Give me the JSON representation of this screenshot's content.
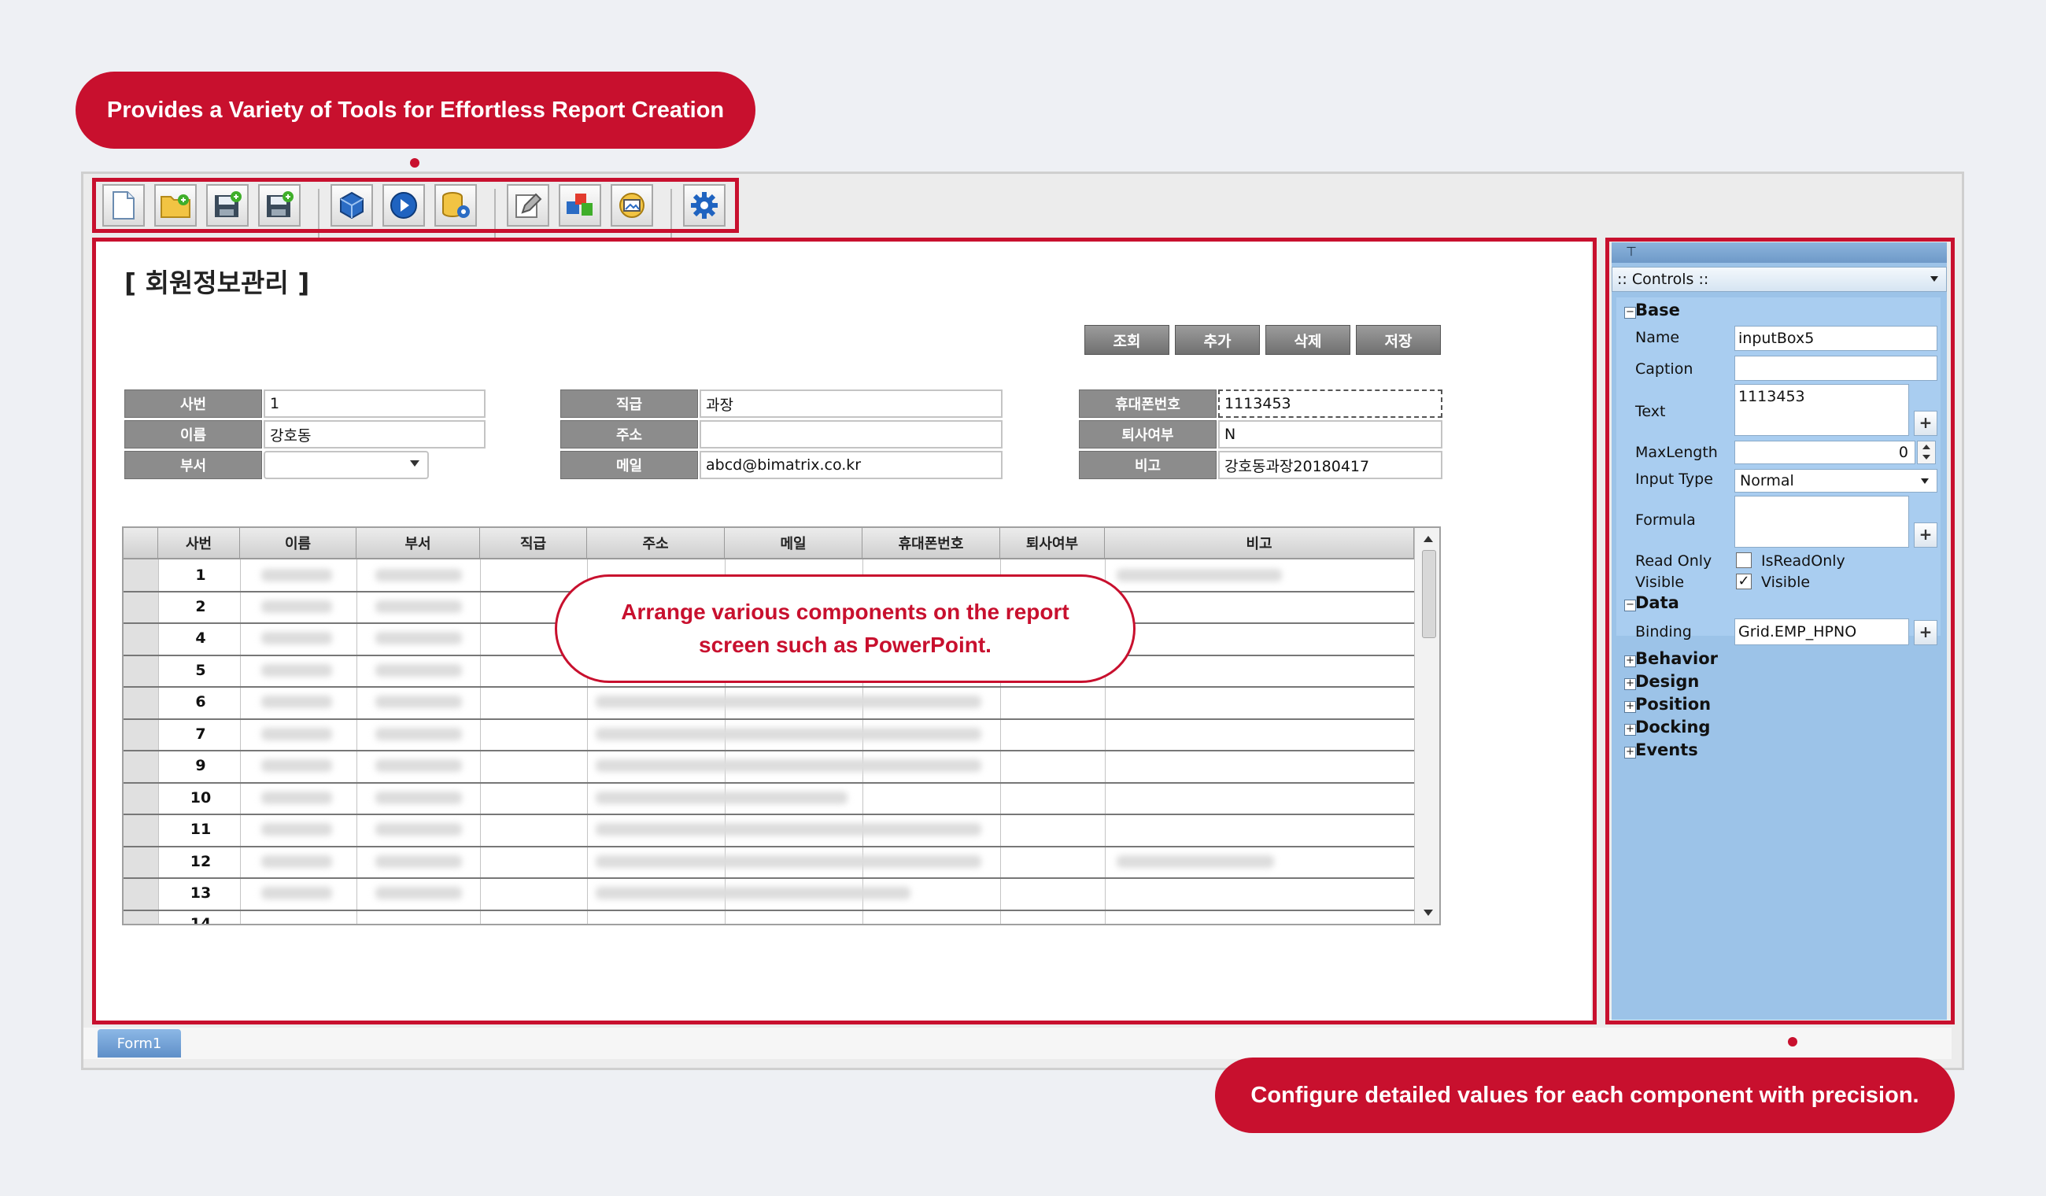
{
  "callouts": {
    "top": "Provides a Variety of Tools for Effortless Report Creation",
    "middle_line1": "Arrange various components on the report",
    "middle_line2": "screen such as PowerPoint.",
    "bottom": "Configure detailed values for each component with precision."
  },
  "colors": {
    "accent": "#c8102e",
    "panel": "#9cc3e8",
    "tab": "#6e9bd0"
  },
  "toolbar": {
    "icons": [
      "new-document-icon",
      "open-folder-icon",
      "save-icon",
      "save-as-icon",
      "component-cube-icon",
      "run-play-icon",
      "database-settings-icon",
      "edit-pencil-icon",
      "color-blocks-icon",
      "image-settings-icon",
      "gear-icon"
    ]
  },
  "form": {
    "title": "[ 회원정보관리 ]",
    "buttons": [
      "조회",
      "추가",
      "삭제",
      "저장"
    ],
    "fields": {
      "emp_no_label": "사번",
      "emp_no_value": "1",
      "name_label": "이름",
      "name_value": "강호동",
      "dept_label": "부서",
      "dept_value": "",
      "position_label": "직급",
      "position_value": "과장",
      "address_label": "주소",
      "address_value": "",
      "email_label": "메일",
      "email_value": "abcd@bimatrix.co.kr",
      "phone_label": "휴대폰번호",
      "phone_value": "1113453",
      "resigned_label": "퇴사여부",
      "resigned_value": "N",
      "note_label": "비고",
      "note_value": "강호동과장20180417"
    }
  },
  "grid": {
    "headers": [
      "사번",
      "이름",
      "부서",
      "직급",
      "주소",
      "메일",
      "휴대폰번호",
      "퇴사여부",
      "비고"
    ],
    "rows": [
      "1",
      "2",
      "4",
      "5",
      "6",
      "7",
      "9",
      "10",
      "11",
      "12",
      "13",
      "14"
    ]
  },
  "props": {
    "header": ":: Controls ::",
    "base": "Base",
    "name_label": "Name",
    "name_value": "inputBox5",
    "caption_label": "Caption",
    "caption_value": "",
    "text_label": "Text",
    "text_value": "1113453",
    "maxlength_label": "MaxLength",
    "maxlength_value": "0",
    "inputtype_label": "Input Type",
    "inputtype_value": "Normal",
    "formula_label": "Formula",
    "formula_value": "",
    "readonly_label": "Read Only",
    "readonly_value": "IsReadOnly",
    "visible_label": "Visible",
    "visible_value": "Visible",
    "data": "Data",
    "binding_label": "Binding",
    "binding_value": "Grid.EMP_HPNO",
    "categories": [
      "Behavior",
      "Design",
      "Position",
      "Docking",
      "Events"
    ]
  },
  "tab": {
    "label": "Form1"
  }
}
